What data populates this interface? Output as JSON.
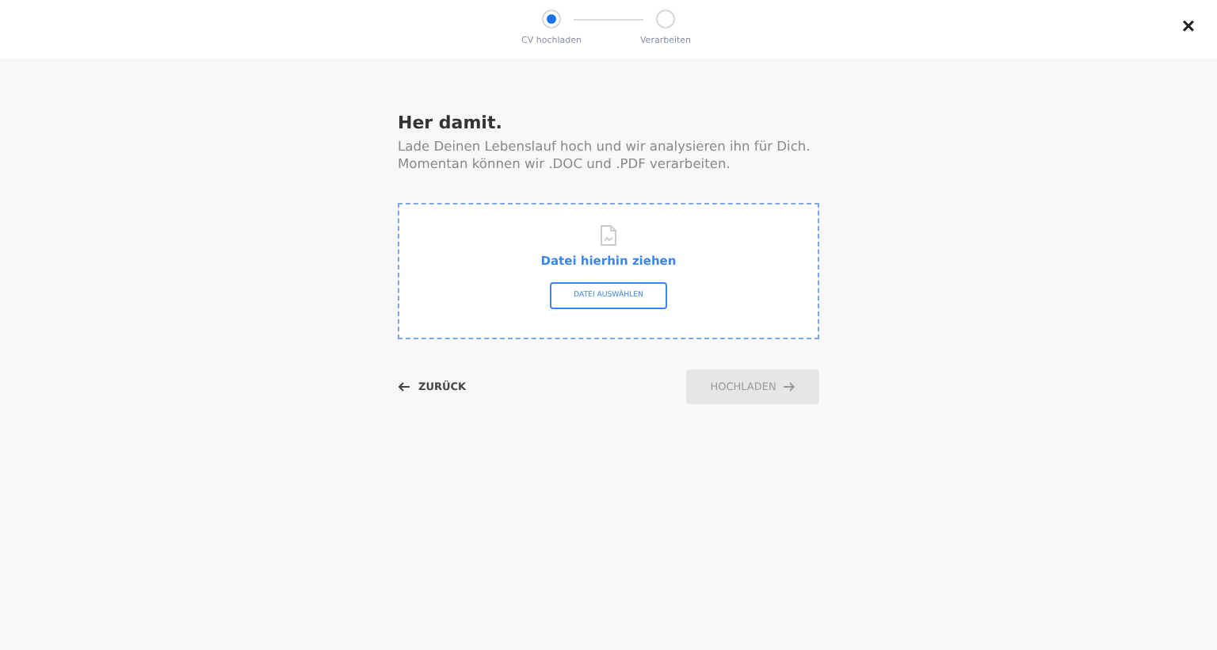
{
  "steps": [
    {
      "label": "CV hochladen",
      "selected": true
    },
    {
      "label": "Verarbeiten",
      "selected": false
    }
  ],
  "close": "×",
  "title": "Her damit.",
  "description": "Lade Deinen Lebenslauf hoch und wir analysieren ihn für Dich. Momentan können wir .DOC und .PDF verarbeiten.",
  "dropzone": {
    "hint": "Datei hierhin ziehen",
    "button": "DATEI AUSWÄHLEN"
  },
  "back": {
    "label": "ZURÜCK"
  },
  "upload": {
    "label": "HOCHLADEN",
    "disabled": true
  }
}
